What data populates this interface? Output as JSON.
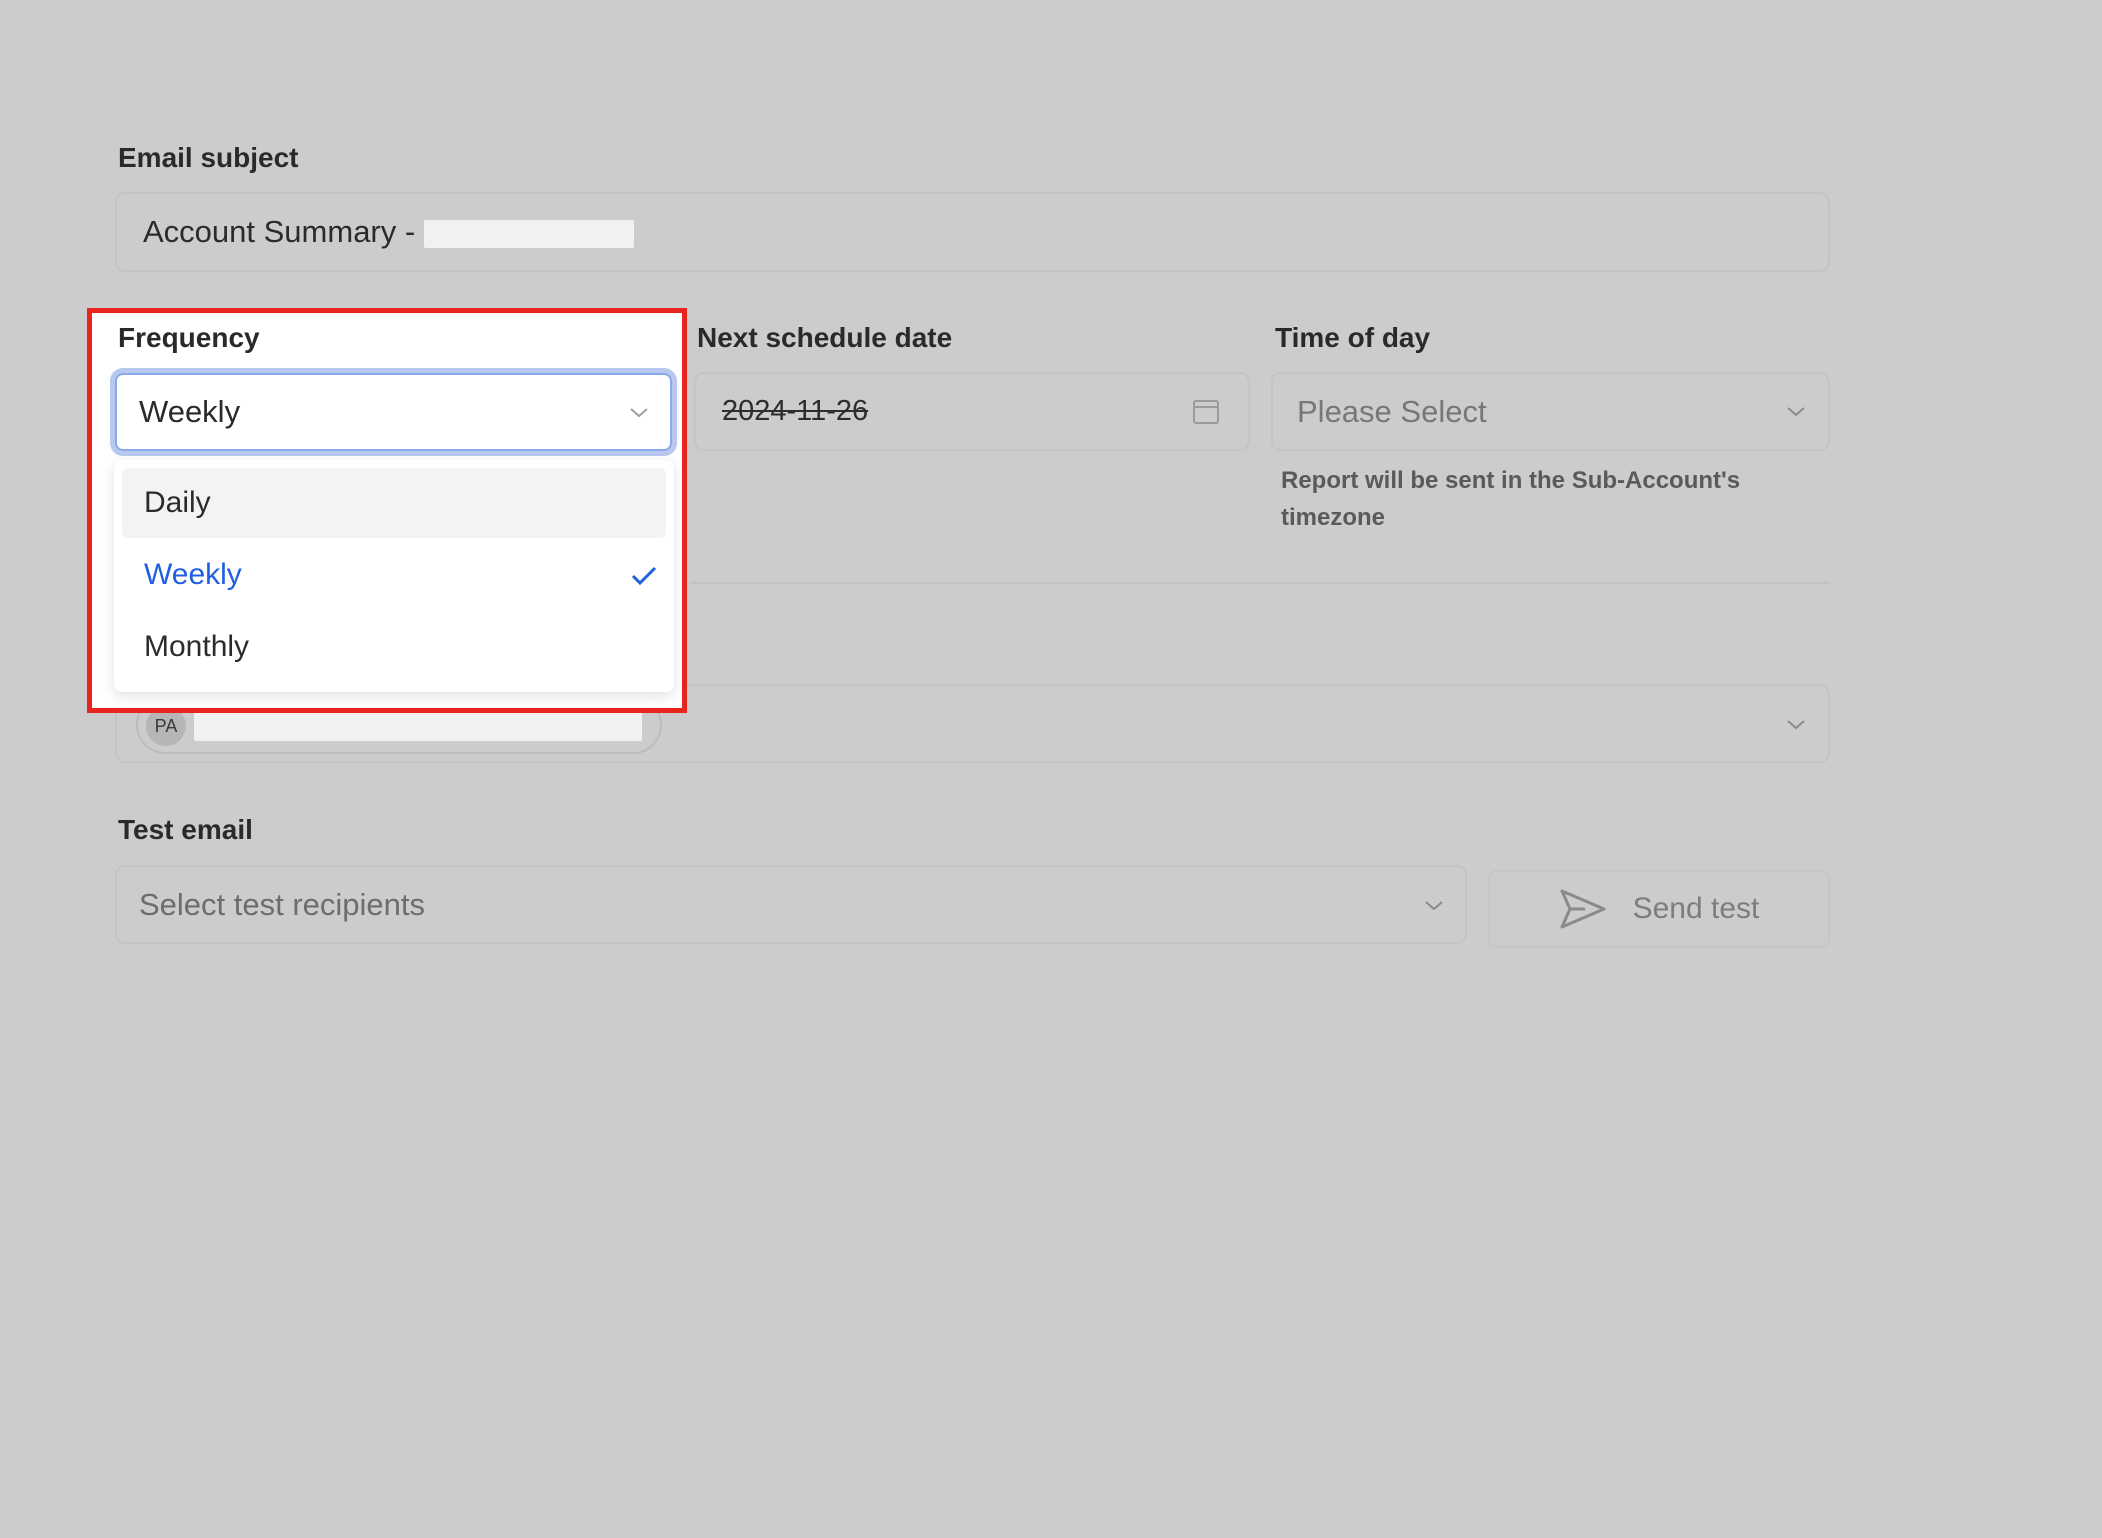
{
  "email_subject": {
    "label": "Email subject",
    "value_prefix": "Account Summary -"
  },
  "frequency": {
    "label": "Frequency",
    "selected": "Weekly",
    "options": [
      "Daily",
      "Weekly",
      "Monthly"
    ]
  },
  "next_schedule": {
    "label": "Next schedule date",
    "value": "2024-11-26"
  },
  "time_of_day": {
    "label": "Time of day",
    "placeholder": "Please Select",
    "helper": "Report will be sent in the Sub-Account's timezone"
  },
  "recipients": {
    "avatar_initials": "PA"
  },
  "test_email": {
    "label": "Test email",
    "placeholder": "Select test recipients",
    "send_label": "Send test"
  },
  "colors": {
    "accent": "#1f5fe0",
    "highlight": "#e8241e",
    "background": "#cccccc"
  }
}
